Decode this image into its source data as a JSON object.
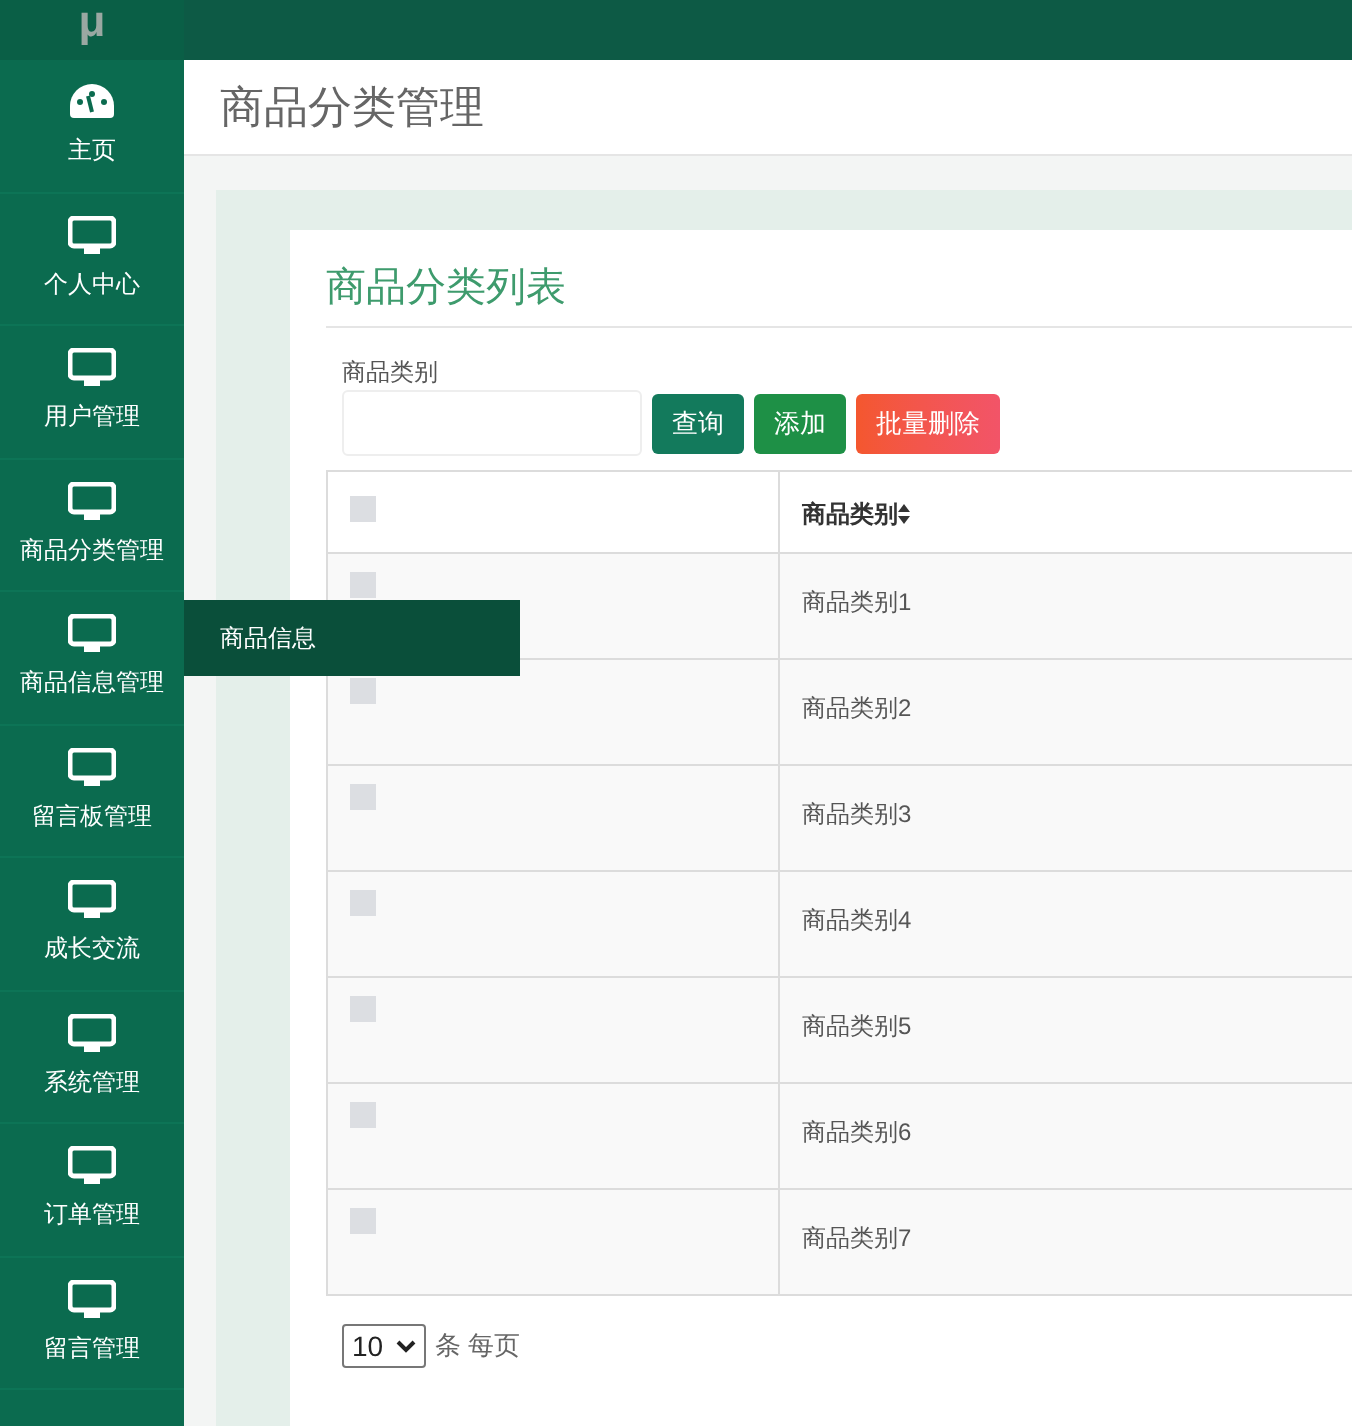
{
  "logo": "μ",
  "sidebar": {
    "items": [
      {
        "label": "主页",
        "kind": "dashboard"
      },
      {
        "label": "个人中心",
        "kind": "monitor"
      },
      {
        "label": "用户管理",
        "kind": "monitor"
      },
      {
        "label": "商品分类管理",
        "kind": "monitor"
      },
      {
        "label": "商品信息管理",
        "kind": "monitor",
        "expanded": true,
        "children": [
          {
            "label": "商品信息"
          }
        ]
      },
      {
        "label": "留言板管理",
        "kind": "monitor"
      },
      {
        "label": "成长交流",
        "kind": "monitor"
      },
      {
        "label": "系统管理",
        "kind": "monitor"
      },
      {
        "label": "订单管理",
        "kind": "monitor"
      },
      {
        "label": "留言管理",
        "kind": "monitor"
      }
    ]
  },
  "page_title": "商品分类管理",
  "card_title": "商品分类列表",
  "search": {
    "label": "商品类别"
  },
  "buttons": [
    {
      "label": "查询",
      "kind": "query"
    },
    {
      "label": "添加",
      "kind": "add"
    },
    {
      "label": "批量删除",
      "kind": "delete"
    }
  ],
  "table": {
    "select_all_checked": false,
    "columns": [
      "商品类别"
    ],
    "rows": [
      {
        "checked": false,
        "cells": [
          "商品类别1"
        ]
      },
      {
        "checked": false,
        "cells": [
          "商品类别2"
        ]
      },
      {
        "checked": false,
        "cells": [
          "商品类别3"
        ]
      },
      {
        "checked": false,
        "cells": [
          "商品类别4"
        ]
      },
      {
        "checked": false,
        "cells": [
          "商品类别5"
        ]
      },
      {
        "checked": false,
        "cells": [
          "商品类别6"
        ]
      },
      {
        "checked": false,
        "cells": [
          "商品类别7"
        ]
      }
    ]
  },
  "pagination": {
    "page_size": "10",
    "suffix": "条 每页"
  }
}
